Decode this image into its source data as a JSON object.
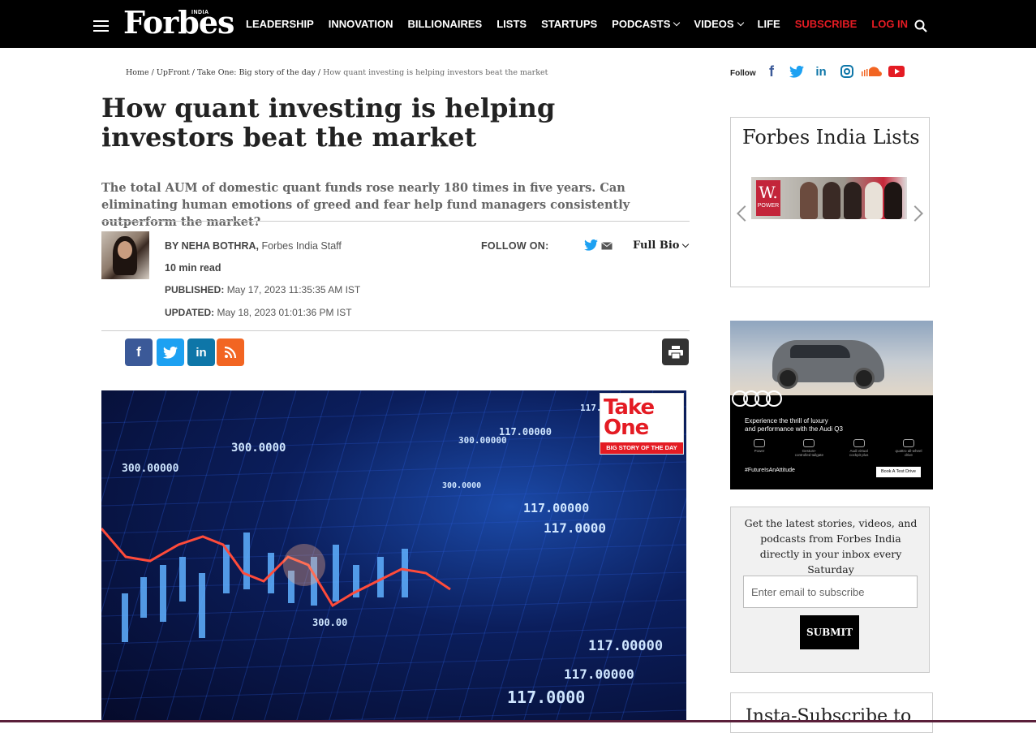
{
  "brand": {
    "logo": "Forbes",
    "edition": "INDIA"
  },
  "nav": [
    {
      "label": "LEADERSHIP",
      "dropdown": false,
      "red": false
    },
    {
      "label": "INNOVATION",
      "dropdown": false,
      "red": false
    },
    {
      "label": "BILLIONAIRES",
      "dropdown": false,
      "red": false
    },
    {
      "label": "LISTS",
      "dropdown": false,
      "red": false
    },
    {
      "label": "STARTUPS",
      "dropdown": false,
      "red": false
    },
    {
      "label": "PODCASTS",
      "dropdown": true,
      "red": false
    },
    {
      "label": "VIDEOS",
      "dropdown": true,
      "red": false
    },
    {
      "label": "LIFE",
      "dropdown": false,
      "red": false
    },
    {
      "label": "SUBSCRIBE",
      "dropdown": false,
      "red": true
    },
    {
      "label": "LOG IN",
      "dropdown": false,
      "red": true
    }
  ],
  "breadcrumb": {
    "home": "Home",
    "sep": " / ",
    "section": "UpFront",
    "subsection": "Take One: Big story of the day",
    "current": "How quant investing is helping investors beat the market"
  },
  "article": {
    "headline": "How quant investing is helping investors beat the market",
    "subhead": "The total AUM of domestic quant funds rose nearly 180 times in five years. Can eliminating human emotions of greed and fear help fund managers consistently outperform the market?",
    "author_prefix": "BY NEHA BOTHRA,",
    "author_role": "Forbes India Staff",
    "read_time": "10 min read",
    "published_label": "PUBLISHED:",
    "published": "May 17, 2023 11:35:35 AM IST",
    "updated_label": "UPDATED:",
    "updated": "May 18, 2023 01:01:36 PM IST",
    "follow_on": "FOLLOW ON:",
    "full_bio": "Full Bio"
  },
  "share": {
    "fb": "f",
    "tw": "t",
    "li": "in",
    "rss": "rss"
  },
  "hero": {
    "badge_line1": "Take",
    "badge_line2": "One",
    "badge_tag": "BIG STORY OF THE DAY",
    "ticker_values": [
      "300.0000",
      "300.00000",
      "117.00000",
      "117.0000",
      "117.00000",
      "117.0000",
      "300.0000",
      "300.00000",
      "117.00000",
      "117.00000",
      "117.0000",
      "300.00"
    ]
  },
  "sidebar": {
    "follow_label": "Follow",
    "social": [
      "facebook",
      "twitter",
      "linkedin",
      "instagram",
      "soundcloud",
      "youtube"
    ],
    "lists_title": "Forbes India Lists",
    "lists_badge": "W.",
    "lists_badge_sub": "POWER",
    "ad_line1": "Experience the thrill of luxury",
    "ad_line2": "and performance with the Audi Q3",
    "ad_hashtag": "#FutureIsAnAttitude",
    "ad_cta": "Book A Test Drive",
    "ad_features": [
      "Power",
      "Gesture-controlled tailgate",
      "Audi virtual cockpit plus",
      "quattro all-wheel drive"
    ],
    "newsletter_text": "Get the latest stories, videos, and podcasts from Forbes India directly in your inbox every Saturday",
    "newsletter_placeholder": "Enter email to subscribe",
    "newsletter_submit": "SUBMIT",
    "insta_title": "Insta-Subscribe to"
  },
  "colors": {
    "accent_red": "#e41b23",
    "topbar": "#000000",
    "fb": "#3b5998",
    "tw": "#1da1f2",
    "li": "#0e76a8",
    "rss": "#f26522"
  }
}
